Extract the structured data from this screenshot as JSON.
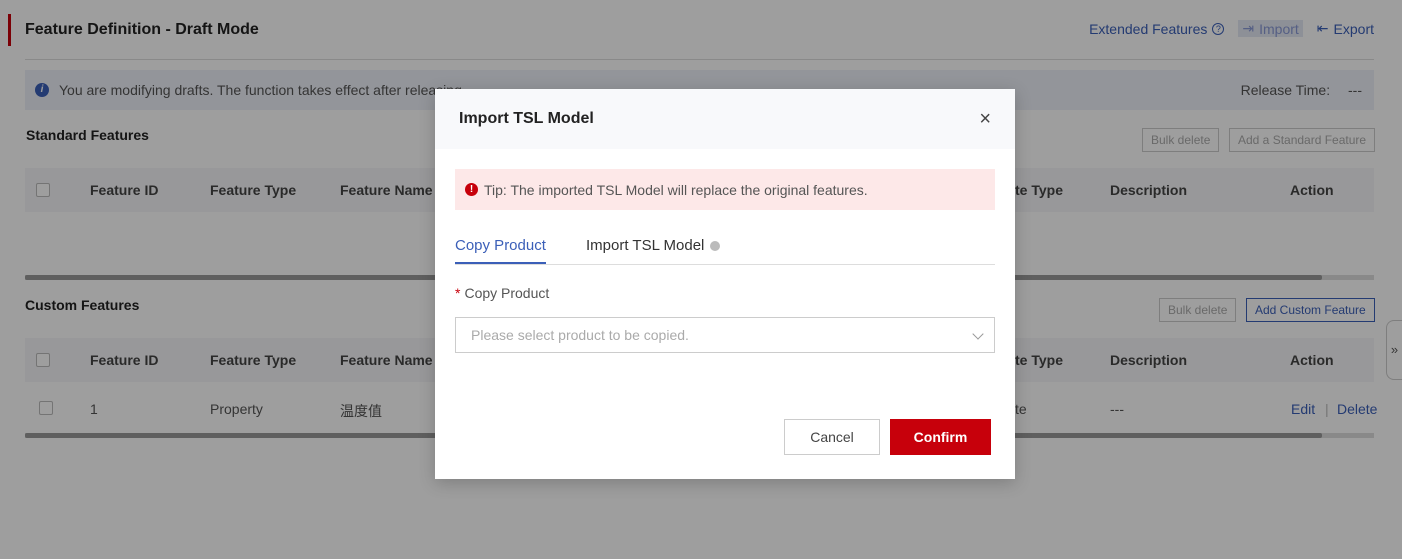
{
  "page": {
    "title": "Feature Definition - Draft Mode",
    "extended_features": "Extended Features",
    "import": "Import",
    "export": "Export",
    "notice": "You are modifying drafts. The function takes effect after releasing.",
    "release_label": "Release Time:",
    "release_value": "---"
  },
  "standard": {
    "title": "Standard Features",
    "bulk_delete": "Bulk delete",
    "add": "Add a Standard Feature",
    "columns": [
      "Feature ID",
      "Feature Type",
      "Feature Name",
      "te Type",
      "Description",
      "Action"
    ]
  },
  "custom": {
    "title": "Custom Features",
    "bulk_delete": "Bulk delete",
    "add": "Add Custom Feature",
    "columns": [
      "Feature ID",
      "Feature Type",
      "Feature Name",
      "te Type",
      "Description",
      "Action"
    ],
    "rows": [
      {
        "id": "1",
        "type": "Property",
        "name": "温度值",
        "data_type": "te",
        "description": "---",
        "edit": "Edit",
        "delete": "Delete"
      }
    ]
  },
  "side_toggle": "»",
  "modal": {
    "title": "Import TSL Model",
    "close": "×",
    "tip": "Tip: The imported TSL Model will replace the original features.",
    "tabs": [
      "Copy Product",
      "Import TSL Model"
    ],
    "field_required": "*",
    "field_label": "Copy Product",
    "select_placeholder": "Please select product to be copied.",
    "cancel": "Cancel",
    "confirm": "Confirm"
  },
  "colors": {
    "brand": "#c7000b",
    "link": "#3b5fb8"
  }
}
